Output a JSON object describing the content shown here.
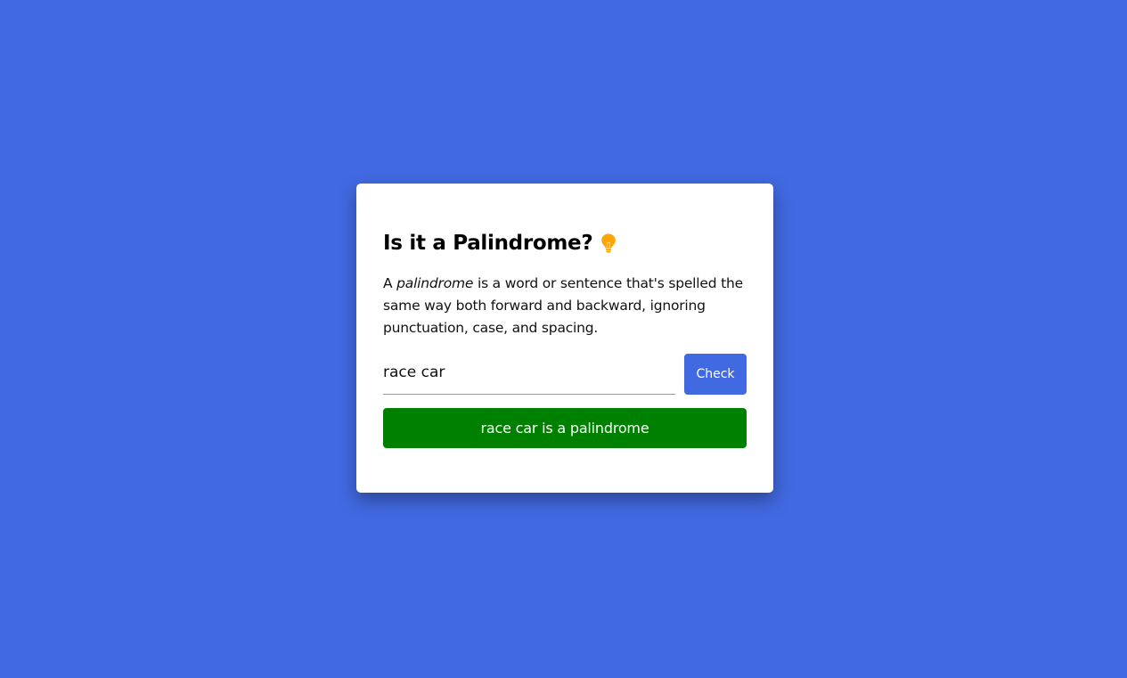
{
  "page": {
    "background_color": "#4169e1"
  },
  "card": {
    "title": "Is it a Palindrome?",
    "title_icon": "lightbulb-icon",
    "description_prefix": "A ",
    "description_emphasis": "palindrome",
    "description_suffix": " is a word or sentence that's spelled the same way both forward and backward, ignoring punctuation, case, and spacing."
  },
  "form": {
    "input_value": "race car",
    "check_label": "Check",
    "button_color": "#4169e1"
  },
  "result": {
    "text": "race car is a palindrome",
    "color": "#008000"
  }
}
